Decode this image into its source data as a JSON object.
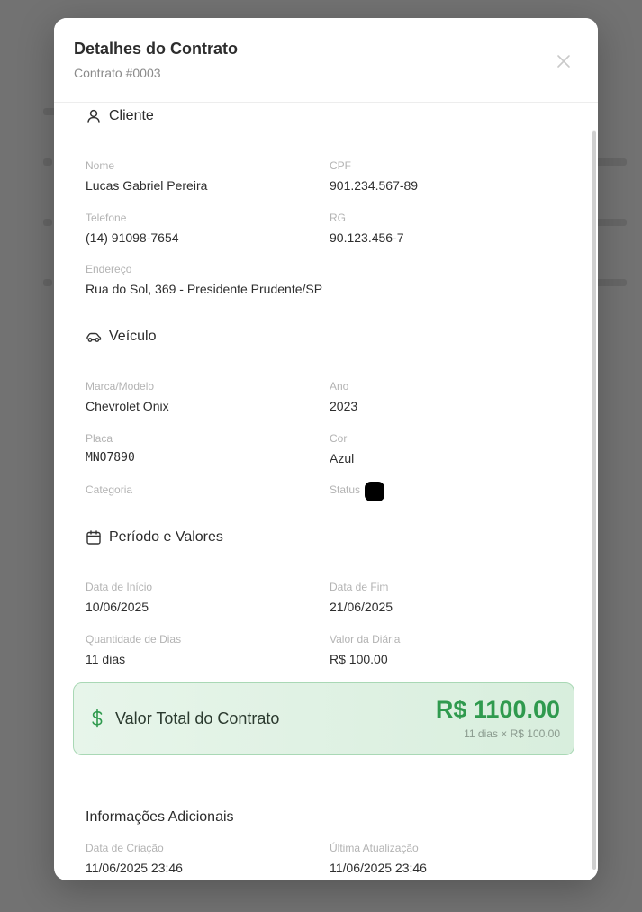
{
  "modal": {
    "title": "Detalhes do Contrato",
    "subtitle": "Contrato #0003",
    "close_icon": "close-icon"
  },
  "cliente": {
    "section_title": "Cliente",
    "icon": "user-icon",
    "nome_label": "Nome",
    "nome": "Lucas Gabriel Pereira",
    "cpf_label": "CPF",
    "cpf": "901.234.567-89",
    "telefone_label": "Telefone",
    "telefone": "(14) 91098-7654",
    "rg_label": "RG",
    "rg": "90.123.456-7",
    "endereco_label": "Endereço",
    "endereco": "Rua do Sol, 369 - Presidente Prudente/SP"
  },
  "veiculo": {
    "section_title": "Veículo",
    "icon": "car-icon",
    "marca_label": "Marca/Modelo",
    "marca": "Chevrolet Onix",
    "ano_label": "Ano",
    "ano": "2023",
    "placa_label": "Placa",
    "placa": "MNO7890",
    "cor_label": "Cor",
    "cor": "Azul",
    "categoria_label": "Categoria",
    "status_label": "Status"
  },
  "periodo": {
    "section_title": "Período e Valores",
    "icon": "calendar-icon",
    "inicio_label": "Data de Início",
    "inicio": "10/06/2025",
    "fim_label": "Data de Fim",
    "fim": "21/06/2025",
    "dias_label": "Quantidade de Dias",
    "dias": "11 dias",
    "diaria_label": "Valor da Diária",
    "diaria": "R$ 100.00"
  },
  "total": {
    "icon": "dollar-icon",
    "label": "Valor Total do Contrato",
    "amount": "R$ 1100.00",
    "calc": "11 dias × R$ 100.00"
  },
  "info": {
    "section_title": "Informações Adicionais",
    "criacao_label": "Data de Criação",
    "criacao": "11/06/2025 23:46",
    "atualizacao_label": "Última Atualização",
    "atualizacao": "11/06/2025 23:46"
  },
  "colors": {
    "accent_green": "#2f9a4e",
    "total_bg": "#e3f3e7",
    "overlay": "rgba(40,40,40,0.58)"
  }
}
